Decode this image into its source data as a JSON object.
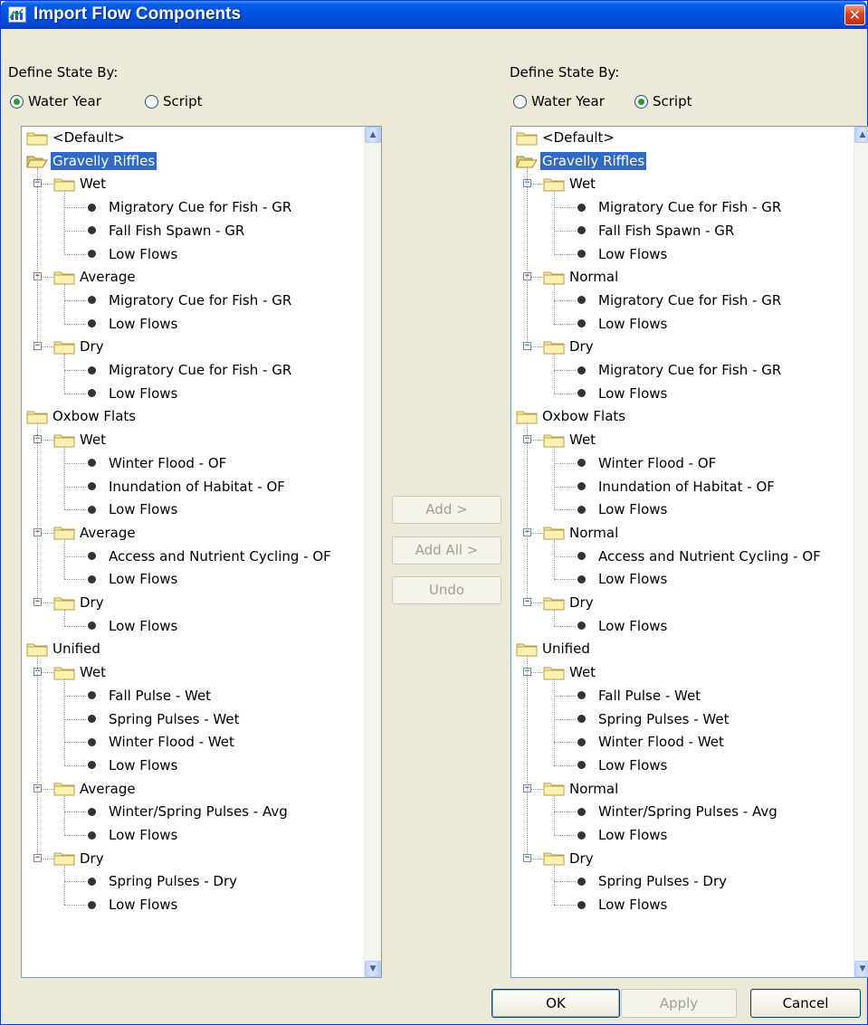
{
  "window": {
    "title": "Import Flow Components",
    "close_glyph": "✕"
  },
  "left": {
    "define_label": "Define State By:",
    "radio_water_year": "Water Year",
    "radio_script": "Script",
    "selected": "water_year"
  },
  "right": {
    "define_label": "Define State By:",
    "radio_water_year": "Water Year",
    "radio_script": "Script",
    "selected": "script"
  },
  "left_tree": [
    {
      "level": 0,
      "type": "folder",
      "label": "<Default>"
    },
    {
      "level": 0,
      "type": "folder",
      "label": "Gravelly Riffles",
      "selected": true,
      "open": true
    },
    {
      "level": 1,
      "type": "folder",
      "label": "Wet"
    },
    {
      "level": 2,
      "type": "leaf",
      "label": "Migratory Cue for Fish - GR"
    },
    {
      "level": 2,
      "type": "leaf",
      "label": "Fall Fish Spawn - GR"
    },
    {
      "level": 2,
      "type": "leaf",
      "label": "Low Flows"
    },
    {
      "level": 1,
      "type": "folder",
      "label": "Average"
    },
    {
      "level": 2,
      "type": "leaf",
      "label": "Migratory Cue for Fish - GR"
    },
    {
      "level": 2,
      "type": "leaf",
      "label": "Low Flows"
    },
    {
      "level": 1,
      "type": "folder",
      "label": "Dry"
    },
    {
      "level": 2,
      "type": "leaf",
      "label": "Migratory Cue for Fish - GR"
    },
    {
      "level": 2,
      "type": "leaf",
      "label": "Low Flows"
    },
    {
      "level": 0,
      "type": "folder",
      "label": "Oxbow Flats"
    },
    {
      "level": 1,
      "type": "folder",
      "label": "Wet"
    },
    {
      "level": 2,
      "type": "leaf",
      "label": "Winter Flood - OF"
    },
    {
      "level": 2,
      "type": "leaf",
      "label": "Inundation of Habitat - OF"
    },
    {
      "level": 2,
      "type": "leaf",
      "label": "Low Flows"
    },
    {
      "level": 1,
      "type": "folder",
      "label": "Average"
    },
    {
      "level": 2,
      "type": "leaf",
      "label": "Access and Nutrient Cycling - OF"
    },
    {
      "level": 2,
      "type": "leaf",
      "label": "Low Flows"
    },
    {
      "level": 1,
      "type": "folder",
      "label": "Dry"
    },
    {
      "level": 2,
      "type": "leaf",
      "label": "Low Flows"
    },
    {
      "level": 0,
      "type": "folder",
      "label": "Unified"
    },
    {
      "level": 1,
      "type": "folder",
      "label": "Wet"
    },
    {
      "level": 2,
      "type": "leaf",
      "label": "Fall Pulse - Wet"
    },
    {
      "level": 2,
      "type": "leaf",
      "label": "Spring Pulses - Wet"
    },
    {
      "level": 2,
      "type": "leaf",
      "label": "Winter Flood - Wet"
    },
    {
      "level": 2,
      "type": "leaf",
      "label": "Low Flows"
    },
    {
      "level": 1,
      "type": "folder",
      "label": "Average"
    },
    {
      "level": 2,
      "type": "leaf",
      "label": "Winter/Spring Pulses - Avg"
    },
    {
      "level": 2,
      "type": "leaf",
      "label": "Low Flows"
    },
    {
      "level": 1,
      "type": "folder",
      "label": "Dry"
    },
    {
      "level": 2,
      "type": "leaf",
      "label": "Spring Pulses - Dry"
    },
    {
      "level": 2,
      "type": "leaf",
      "label": "Low Flows"
    }
  ],
  "right_tree": [
    {
      "level": 0,
      "type": "folder",
      "label": "<Default>"
    },
    {
      "level": 0,
      "type": "folder",
      "label": "Gravelly Riffles",
      "selected": true,
      "open": true
    },
    {
      "level": 1,
      "type": "folder",
      "label": "Wet"
    },
    {
      "level": 2,
      "type": "leaf",
      "label": "Migratory Cue for Fish - GR"
    },
    {
      "level": 2,
      "type": "leaf",
      "label": "Fall Fish Spawn - GR"
    },
    {
      "level": 2,
      "type": "leaf",
      "label": "Low Flows"
    },
    {
      "level": 1,
      "type": "folder",
      "label": "Normal"
    },
    {
      "level": 2,
      "type": "leaf",
      "label": "Migratory Cue for Fish - GR"
    },
    {
      "level": 2,
      "type": "leaf",
      "label": "Low Flows"
    },
    {
      "level": 1,
      "type": "folder",
      "label": "Dry"
    },
    {
      "level": 2,
      "type": "leaf",
      "label": "Migratory Cue for Fish - GR"
    },
    {
      "level": 2,
      "type": "leaf",
      "label": "Low Flows"
    },
    {
      "level": 0,
      "type": "folder",
      "label": "Oxbow Flats"
    },
    {
      "level": 1,
      "type": "folder",
      "label": "Wet"
    },
    {
      "level": 2,
      "type": "leaf",
      "label": "Winter Flood - OF"
    },
    {
      "level": 2,
      "type": "leaf",
      "label": "Inundation of Habitat - OF"
    },
    {
      "level": 2,
      "type": "leaf",
      "label": "Low Flows"
    },
    {
      "level": 1,
      "type": "folder",
      "label": "Normal"
    },
    {
      "level": 2,
      "type": "leaf",
      "label": "Access and Nutrient Cycling - OF"
    },
    {
      "level": 2,
      "type": "leaf",
      "label": "Low Flows"
    },
    {
      "level": 1,
      "type": "folder",
      "label": "Dry"
    },
    {
      "level": 2,
      "type": "leaf",
      "label": "Low Flows"
    },
    {
      "level": 0,
      "type": "folder",
      "label": "Unified"
    },
    {
      "level": 1,
      "type": "folder",
      "label": "Wet"
    },
    {
      "level": 2,
      "type": "leaf",
      "label": "Fall Pulse - Wet"
    },
    {
      "level": 2,
      "type": "leaf",
      "label": "Spring Pulses - Wet"
    },
    {
      "level": 2,
      "type": "leaf",
      "label": "Winter Flood - Wet"
    },
    {
      "level": 2,
      "type": "leaf",
      "label": "Low Flows"
    },
    {
      "level": 1,
      "type": "folder",
      "label": "Normal"
    },
    {
      "level": 2,
      "type": "leaf",
      "label": "Winter/Spring Pulses - Avg"
    },
    {
      "level": 2,
      "type": "leaf",
      "label": "Low Flows"
    },
    {
      "level": 1,
      "type": "folder",
      "label": "Dry"
    },
    {
      "level": 2,
      "type": "leaf",
      "label": "Spring Pulses - Dry"
    },
    {
      "level": 2,
      "type": "leaf",
      "label": "Low Flows"
    }
  ],
  "middle": {
    "add": "Add >",
    "add_all": "Add All >",
    "undo": "Undo"
  },
  "footer": {
    "ok": "OK",
    "apply": "Apply",
    "cancel": "Cancel"
  },
  "colors": {
    "title_bar": "#0054e3",
    "selection": "#316ac5",
    "radio_dot": "#21a121"
  },
  "icons": {
    "app": "chart-icon",
    "close": "close-icon",
    "folder": "folder-icon",
    "leaf": "bullet-icon",
    "expander": "collapse-icon",
    "scroll_up": "scroll-up-icon",
    "scroll_down": "scroll-down-icon"
  }
}
